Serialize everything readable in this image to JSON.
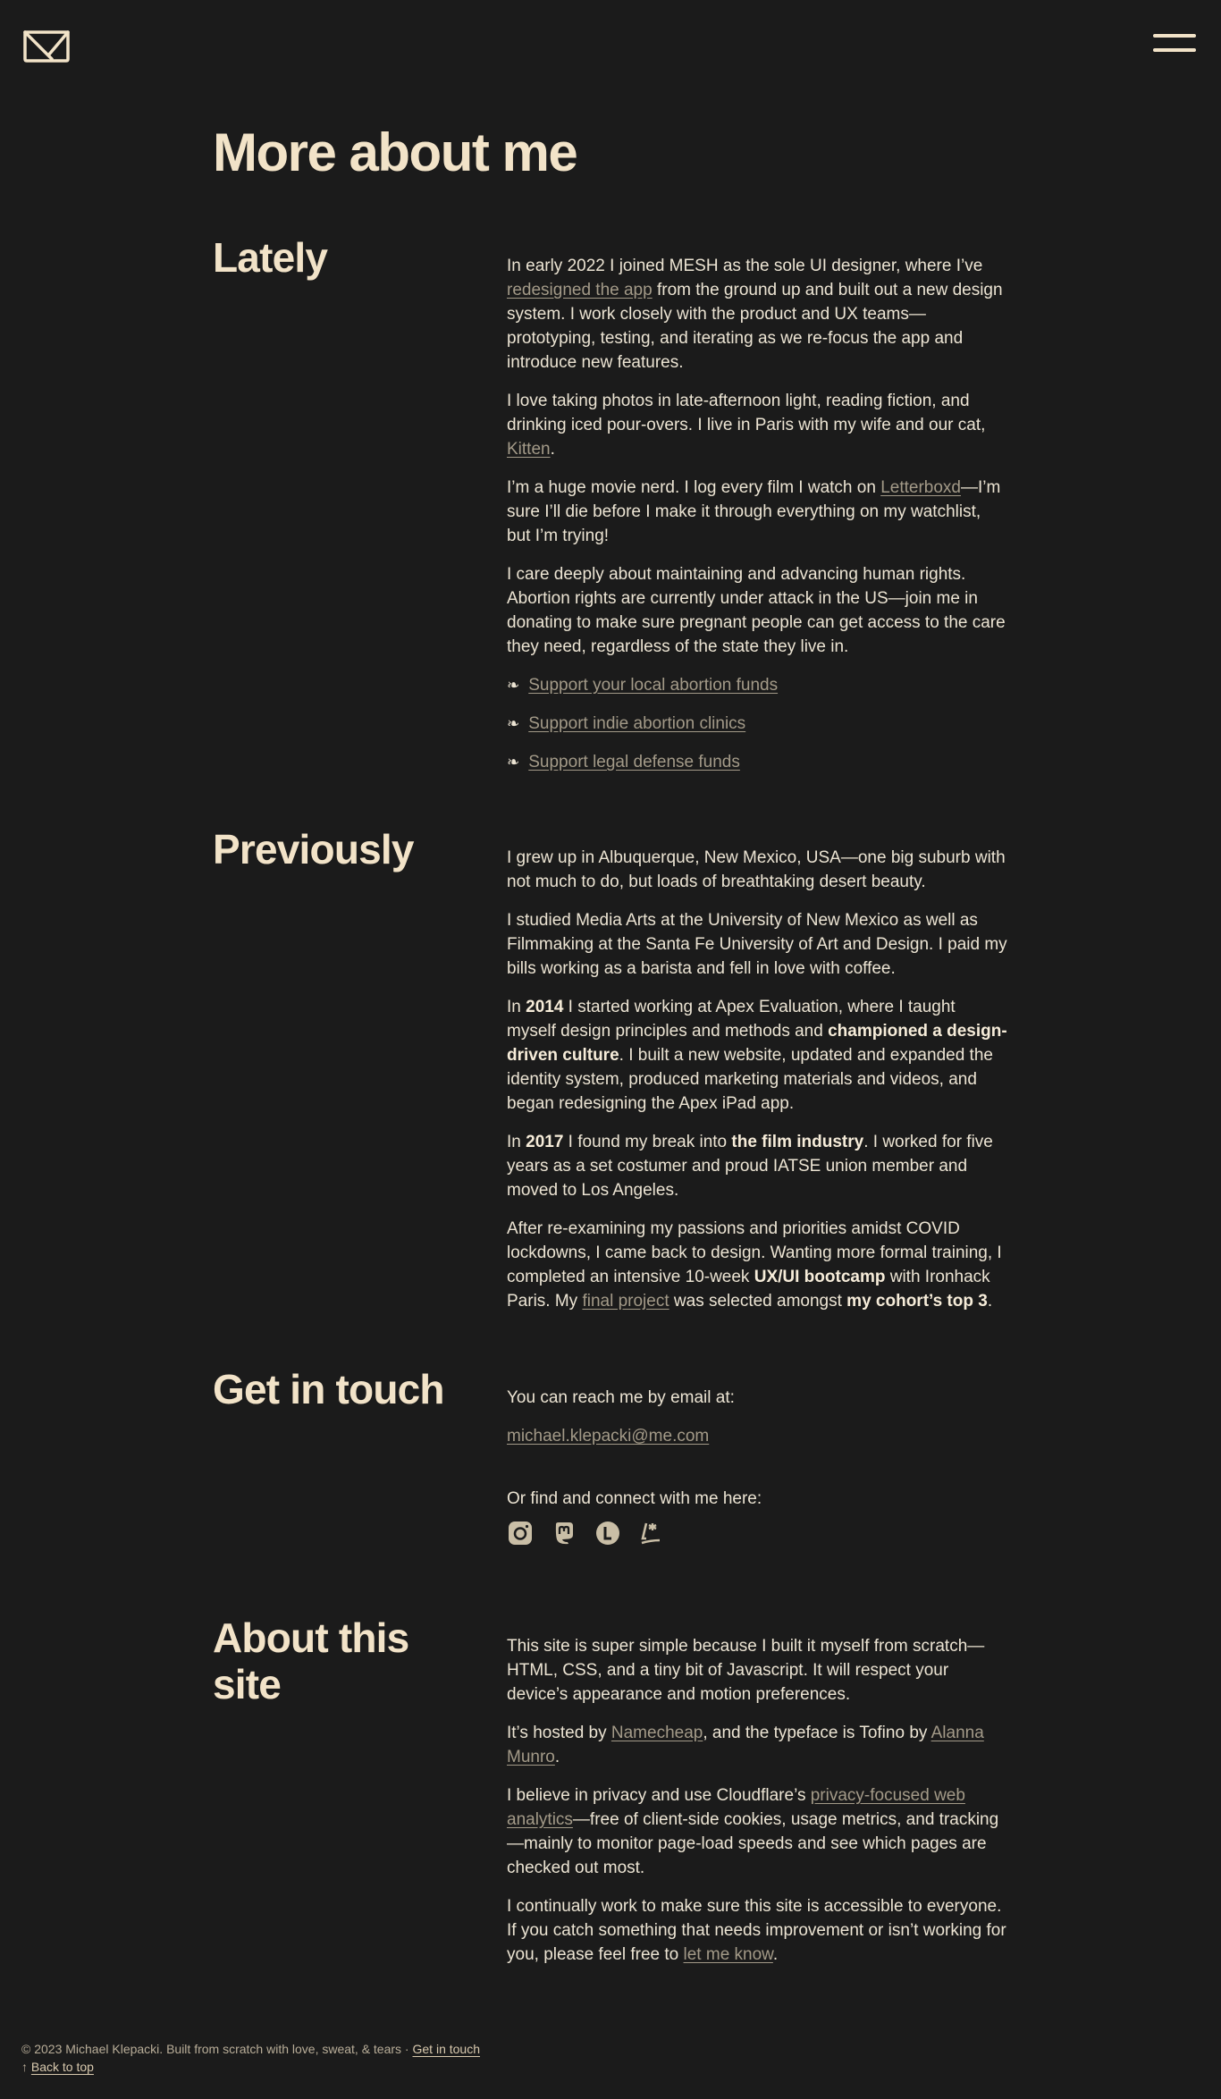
{
  "header": {
    "logo_icon": "envelope-icon",
    "menu_icon": "hamburger-menu-icon"
  },
  "page_title": "More about me",
  "lately": {
    "heading": "Lately",
    "p1_a": "In early 2022 I joined MESH as the sole UI designer, where I’ve ",
    "p1_link": "redesigned the app",
    "p1_b": " from the ground up and built out a new design system. I work closely with the product and UX teams—prototyping, testing, and iterating as we re-focus the app and introduce new features.",
    "p2_a": "I love taking photos in late-afternoon light, reading fiction, and drinking iced pour-overs. I live in Paris with my wife and our cat, ",
    "p2_link": "Kitten",
    "p2_b": ".",
    "p3_a": "I’m a huge movie nerd. I log every film I watch on ",
    "p3_link": "Letterboxd",
    "p3_b": "—I’m sure I’ll die before I make it through everything on my watchlist, but I’m trying!",
    "p4": "I care deeply about maintaining and advancing human rights. Abortion rights are currently under attack in the US—join me in donating to make sure pregnant people can get access to the care they need, regardless of the state they live in.",
    "bullet_mark": "❧",
    "links": [
      "Support your local abortion funds",
      "Support indie abortion clinics",
      "Support legal defense funds"
    ]
  },
  "previously": {
    "heading": "Previously",
    "p1": "I grew up in Albuquerque, New Mexico, USA—one big suburb with not much to do, but loads of breathtaking desert beauty.",
    "p2": "I studied Media Arts at the University of New Mexico as well as Filmmaking at the Santa Fe University of Art and Design. I paid my bills working as a barista and fell in love with coffee.",
    "p3_a": "In ",
    "p3_b1": "2014",
    "p3_c": " I started working at Apex Evaluation, where I taught myself design principles and methods and ",
    "p3_b2": "championed a design-driven culture",
    "p3_d": ". I built a new website, updated and expanded the identity system, produced marketing materials and videos, and began redesigning the Apex iPad app.",
    "p4_a": "In ",
    "p4_b1": "2017",
    "p4_c": " I found my break into ",
    "p4_b2": "the film industry",
    "p4_d": ". I worked for five years as a set costumer and proud IATSE union member and moved to Los Angeles.",
    "p5_a": "After re-examining my passions and priorities amidst COVID lockdowns, I came back to design. Wanting more formal training, I completed an intensive 10-week ",
    "p5_b1": "UX/UI bootcamp",
    "p5_c": " with Ironhack Paris. My ",
    "p5_link": "final project",
    "p5_d": " was selected amongst ",
    "p5_b2": "my cohort’s top 3",
    "p5_e": "."
  },
  "contact": {
    "heading": "Get in touch",
    "email_intro": "You can reach me by email at:",
    "email": "michael.klepacki@me.com",
    "social_intro": "Or find and connect with me here:",
    "socials": [
      "instagram-icon",
      "mastodon-icon",
      "letterboxd-icon",
      "read-cv-icon"
    ]
  },
  "about": {
    "heading": "About this site",
    "p1": "This site is super simple because I built it myself from scratch—HTML, CSS, and a tiny bit of Javascript. It will respect your device’s appearance and motion preferences.",
    "p2_a": "It’s hosted by ",
    "p2_link1": "Namecheap",
    "p2_b": ", and the typeface is Tofino by ",
    "p2_link2": "Alanna Munro",
    "p2_c": ".",
    "p3_a": "I believe in privacy and use Cloudflare’s ",
    "p3_link": "privacy-focused web analytics",
    "p3_b": "—free of client-side cookies, usage metrics, and tracking—mainly to monitor page-load speeds and see which pages are checked out most.",
    "p4_a": "I continually work to make sure this site is accessible to everyone. If you catch something that needs improvement or isn’t working for you, please feel free to ",
    "p4_link": "let me know",
    "p4_b": "."
  },
  "footer": {
    "copyright": "© 2023 Michael Klepacki. Built from scratch with love, sweat, & tears",
    "separator": " · ",
    "contact_link": "Get in touch",
    "arrow": "↑ ",
    "back_to_top": "Back to top"
  }
}
